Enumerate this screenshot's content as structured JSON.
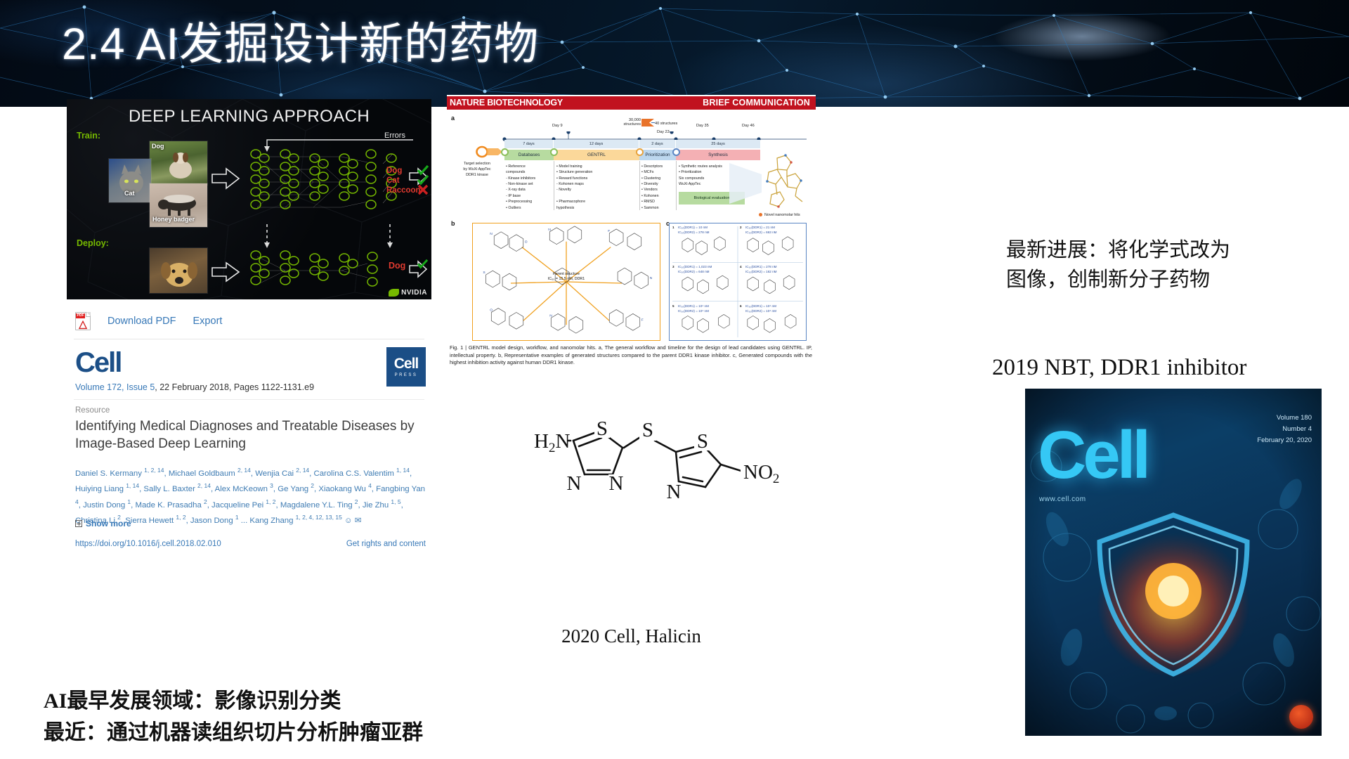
{
  "slide": {
    "title": "2.4 AI发掘设计新的药物"
  },
  "nvidia_figure": {
    "heading": "DEEP LEARNING APPROACH",
    "train_label": "Train:",
    "deploy_label": "Deploy:",
    "errors_label": "Errors",
    "train_photo_captions": [
      "Dog",
      "Cat",
      "Honey badger"
    ],
    "output_labels": [
      {
        "text": "Dog",
        "mark": "check"
      },
      {
        "text": "Cat",
        "mark": "check"
      },
      {
        "text": "Raccoon",
        "mark": "cross"
      }
    ],
    "deploy_output": {
      "text": "Dog",
      "mark": "check"
    },
    "brand": "NVIDIA",
    "accent_color": "#76b900"
  },
  "science_direct": {
    "download_pdf_label": "Download PDF",
    "export_label": "Export",
    "journal_logo_text": "Cell",
    "journal_badge": {
      "main": "Cell",
      "sub": "PRESS"
    },
    "volume_line_link": "Volume 172, Issue 5",
    "volume_line_rest": ", 22 February 2018, Pages 1122-1131.e9",
    "article_type": "Resource",
    "article_title": "Identifying Medical Diagnoses and Treatable Diseases by Image-Based Deep Learning",
    "authors_html": "Daniel S. Kermany <sup>1, 2, 14</sup>, Michael Goldbaum <sup>2, 14</sup>, Wenjia Cai <sup>2, 14</sup>, Carolina C.S. Valentim <sup>1, 14</sup>, Huiying Liang <sup>1, 14</sup>, Sally L. Baxter <sup>2, 14</sup>, Alex McKeown <sup>3</sup>, Ge Yang <sup>2</sup>, Xiaokang Wu <sup>4</sup>, Fangbing Yan <sup>4</sup>, Justin Dong <sup>1</sup>, Made K. Prasadha <sup>2</sup>, Jacqueline Pei <sup>1, 2</sup>, Magdalene Y.L. Ting <sup>2</sup>, Jie Zhu <sup>1, 5</sup>, Christina Li <sup>2</sup>, Sierra Hewett <sup>1, 2</sup>, Jason Dong <sup>1</sup> ... Kang Zhang <sup>1, 2, 4, 12, 13, 15</sup> &#9786; &#9993;",
    "show_more_label": "Show more",
    "doi": "https://doi.org/10.1016/j.cell.2018.02.010",
    "get_rights_label": "Get rights and content",
    "link_color": "#3778b7"
  },
  "nbt_figure": {
    "masthead_left": "NATURE BIOTECHNOLOGY",
    "masthead_right": "BRIEF COMMUNICATION",
    "masthead_color": "#c1121f",
    "panel_a_letter": "a",
    "panel_b_letter": "b",
    "panel_c_letter": "c",
    "target_selection": "Target selection\nby WuXi AppTec\nDDR1 kinase",
    "timeline_days": [
      "Day 9",
      "Day 23",
      "Day 35",
      "Day 46"
    ],
    "timeline_durations": [
      "7 days",
      "12 days",
      "2 days",
      "25 days"
    ],
    "structures_note_from": "30,000\nstructures",
    "structures_note_to": "40 structures",
    "stages": [
      {
        "name": "Databases",
        "color": "#b7dba0",
        "bullets": "• Reference\n  compounds\n  - Kinase inhibitors\n  - Non-kinase set\n  - X-ray data\n  - IP base\n• Preprocessing\n• Outliers"
      },
      {
        "name": "GENTRL",
        "color": "#fbd89a",
        "bullets": "• Model training\n• Structure generation\n• Reward functions\n  - Kohonen maps\n  - Novelty\n\n• Pharmacophore\n  hypothesis"
      },
      {
        "name": "Prioritization",
        "color": "#bcd7ee",
        "bullets": "• Descriptors\n• MCFs\n• Clustering\n• Diversity\n• Vendors\n• Kohonen\n• RMSD\n• Sammon"
      },
      {
        "name": "Synthesis",
        "color": "#f4b0b4",
        "bullets": "• Synthetic routes analysis\n• Prioritization\n  Six compounds\n  WuXi AppTec\n\n• IP assessment"
      }
    ],
    "biological_evaluation": "Biological evaluation",
    "novel_hits_label": "Novel nanomolar hits",
    "parent_structure_label": "Parent structure\nIC₅₀ = 15.5 nM, DDR1",
    "panel_c_entries": [
      {
        "idx": "1",
        "l1": "IC₅₀(DDR1) = 10 nM",
        "l2": "IC₅₀(DDR2) = 278 nM"
      },
      {
        "idx": "2",
        "l1": "IC₅₀(DDR1) = 21 nM",
        "l2": "IC₅₀(DDR2) = 663 nM"
      },
      {
        "idx": "3",
        "l1": "IC₅₀(DDR1) = 1,023 nM",
        "l2": "IC₅₀(DDR2) = 648 nM"
      },
      {
        "idx": "4",
        "l1": "IC₅₀(DDR1) = 278 nM",
        "l2": "IC₅₀(DDR2) = 162 nM"
      },
      {
        "idx": "5",
        "l1": "IC₅₀(DDR1) = 10⁴ nM",
        "l2": "IC₅₀(DDR2) = 10⁴ nM"
      },
      {
        "idx": "6",
        "l1": "IC₅₀(DDR1) = 10⁴ nM",
        "l2": "IC₅₀(DDR2) = 10⁴ nM"
      }
    ],
    "caption": "Fig. 1 | GENTRL model design, workflow, and nanomolar hits. a, The general workflow and timeline for the design of lead candidates using GENTRL. IP, intellectual property. b, Representative examples of generated structures compared to the parent DDR1 kinase inhibitor. c, Generated compounds with the highest inhibition activity against human DDR1 kinase."
  },
  "halicin": {
    "caption": "2020 Cell, Halicin",
    "atom_labels": [
      "H₂N",
      "S",
      "S",
      "N",
      "N",
      "S",
      "N",
      "NO₂"
    ]
  },
  "right_column": {
    "note": "最新进展：将化学式改为\n图像，创制新分子药物",
    "heading": "2019 NBT, DDR1 inhibitor",
    "cover": {
      "wordmark": "Cell",
      "meta": "Volume 180\nNumber 4\nFebruary 20, 2020",
      "url": "www.cell.com"
    }
  },
  "bottom_notes": {
    "line1": "AI最早发展领域：影像识别分类",
    "line2": "最近：通过机器读组织切片分析肿瘤亚群"
  }
}
